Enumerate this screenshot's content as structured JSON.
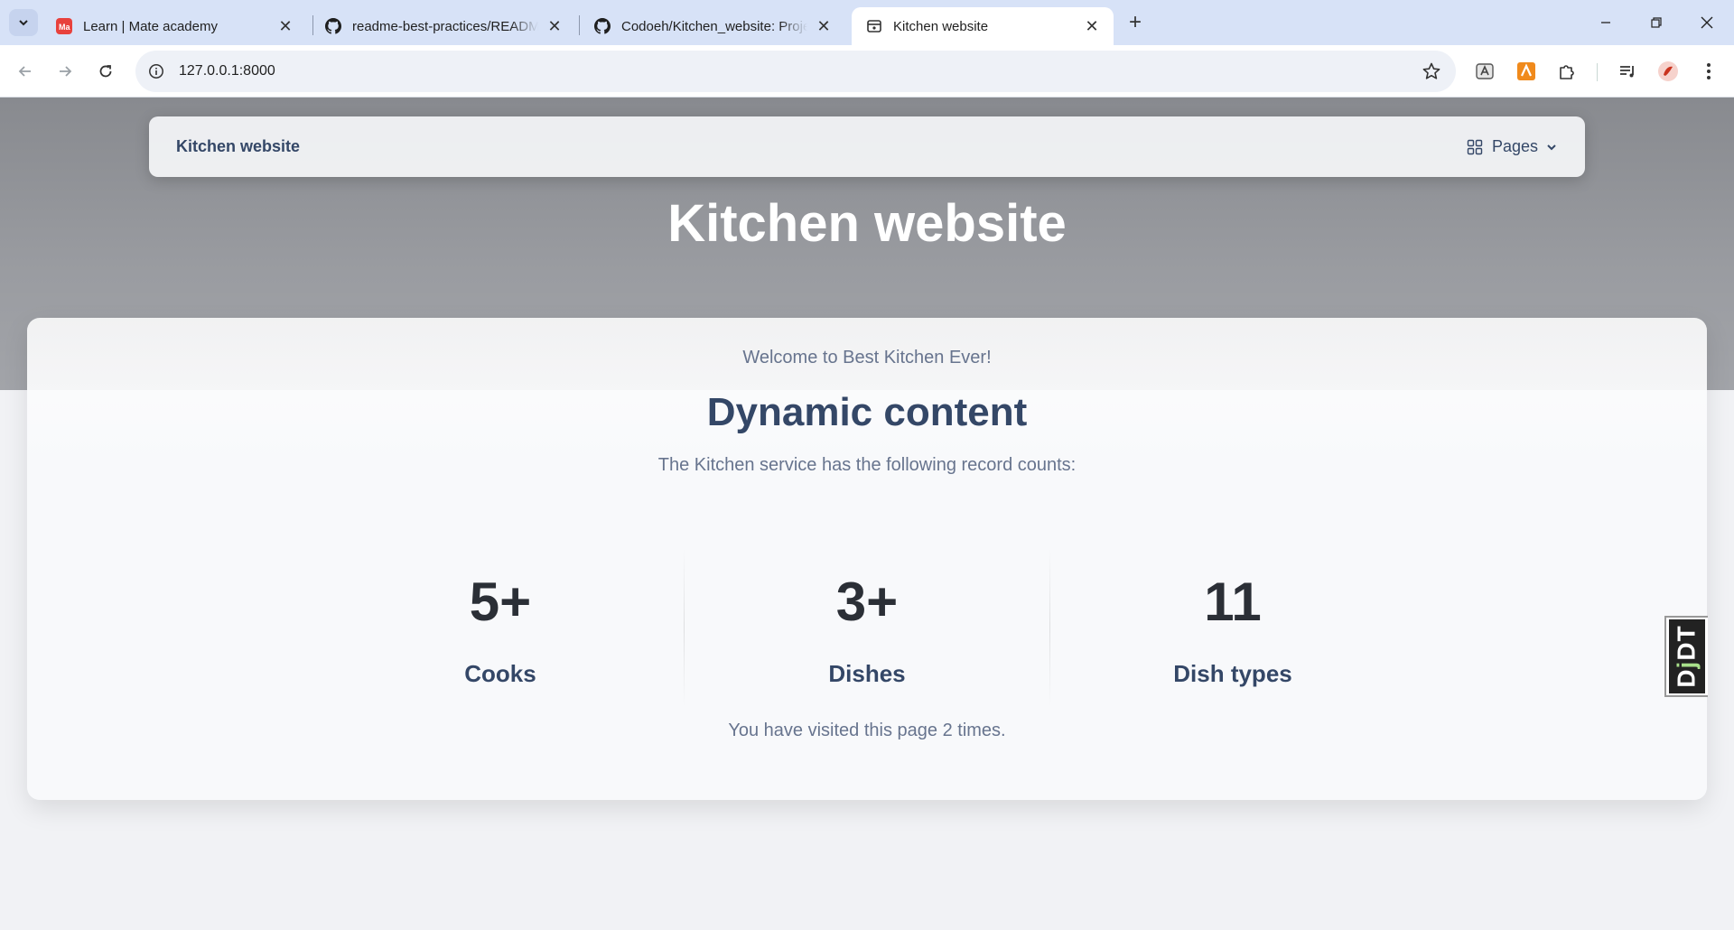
{
  "browser": {
    "tabs": [
      {
        "title": "Learn | Mate academy",
        "favicon": "mate-academy-icon"
      },
      {
        "title": "readme-best-practices/README.md",
        "favicon": "github-icon"
      },
      {
        "title": "Codoeh/Kitchen_website: Project",
        "favicon": "github-icon"
      },
      {
        "title": "Kitchen website",
        "favicon": "page-icon"
      }
    ],
    "url": "127.0.0.1:8000"
  },
  "navbar": {
    "brand": "Kitchen website",
    "pages_label": "Pages"
  },
  "hero": {
    "title": "Kitchen website"
  },
  "main": {
    "subtitle": "Welcome to Best Kitchen Ever!",
    "heading": "Dynamic content",
    "lead": "The Kitchen service has the following record counts:",
    "stats": [
      {
        "value": "5+",
        "label": "Cooks"
      },
      {
        "value": "3+",
        "label": "Dishes"
      },
      {
        "value": "11",
        "label": "Dish types"
      }
    ],
    "visits": "You have visited this page 2 times."
  },
  "debug_toolbar": {
    "label_d": "D",
    "label_j": "j",
    "label_dt": "DT"
  },
  "colors": {
    "tabbar": "#d7e2f7",
    "hero": "#9a9ca1",
    "heading": "#344767",
    "muted": "#67748e"
  }
}
